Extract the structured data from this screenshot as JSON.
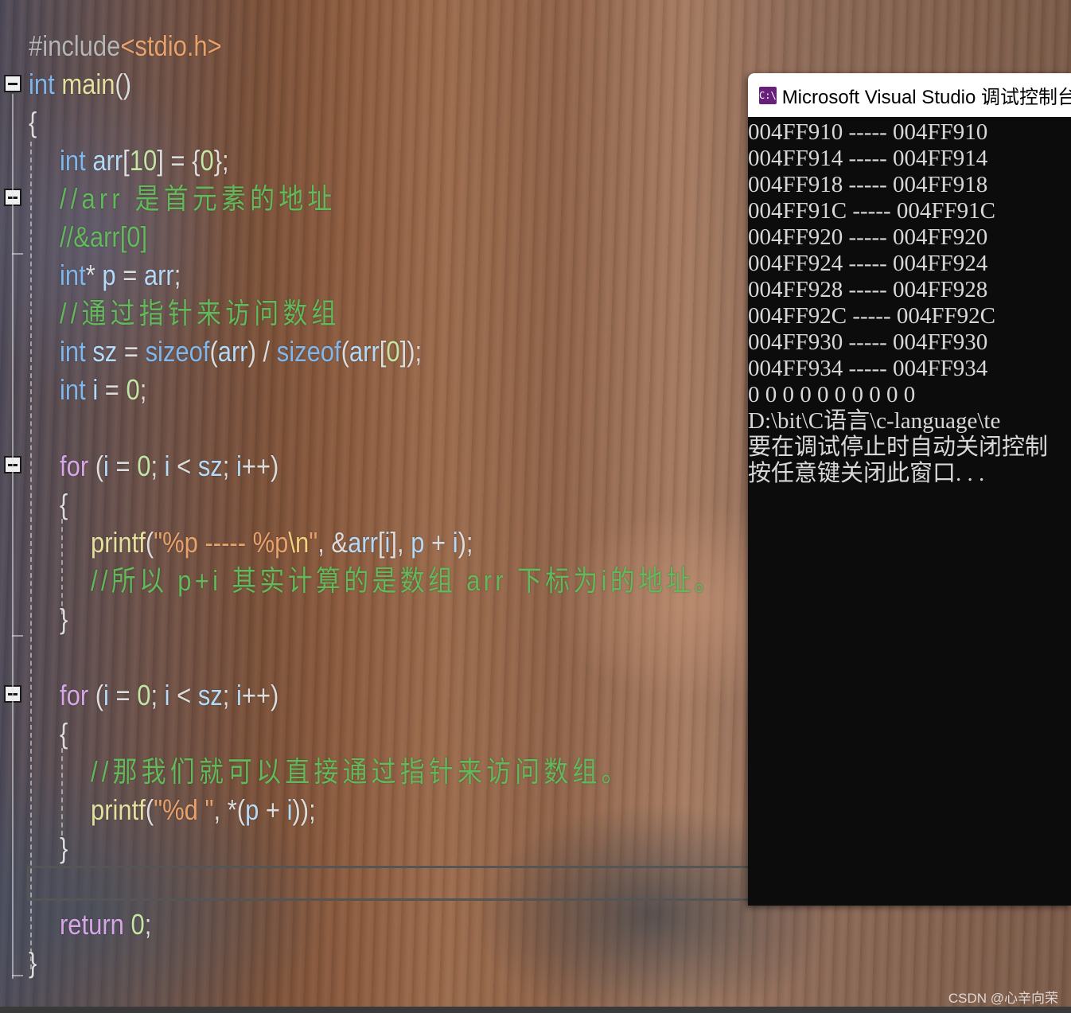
{
  "editor": {
    "line1": {
      "directive": "#include",
      "open": "<",
      "header": "stdio.h",
      "close": ">"
    },
    "line2": {
      "type": "int",
      "name": "main",
      "parens": "()"
    },
    "brace_open": "{",
    "line4": {
      "type": "int",
      "arr": "arr",
      "lb": "[",
      "size": "10",
      "rb": "]",
      "eq": " = {",
      "zero": "0",
      "end": "};"
    },
    "comment1": "//arr 是首元素的地址",
    "comment2": "//&arr[0]",
    "line7": {
      "type": "int",
      "star": "*",
      "p": "p",
      "eq": " = ",
      "arr": "arr",
      "end": ";"
    },
    "comment3": "//通过指针来访问数组",
    "line9": {
      "type": "int",
      "sz": "sz",
      "eq": " = ",
      "fn1": "sizeof",
      "lp1": "(",
      "arr1": "arr",
      "mid": ") / ",
      "fn2": "sizeof",
      "lp2": "(",
      "arr2": "arr",
      "lb": "[",
      "zero": "0",
      "end": "]);"
    },
    "line10": {
      "type": "int",
      "i": "i",
      "eq": " = ",
      "zero": "0",
      "end": ";"
    },
    "for1": {
      "kw": "for",
      "lp": " (",
      "i1": "i",
      "eq": " = ",
      "zero": "0",
      "semi1": "; ",
      "i2": "i",
      "lt": " < ",
      "sz": "sz",
      "semi2": "; ",
      "i3": "i",
      "inc": "++)"
    },
    "for1_open": "{",
    "printf1": {
      "fn": "printf",
      "lp": "(",
      "str": "\"%p ----- %p",
      "esc": "\\n",
      "strend": "\"",
      "comma1": ", &",
      "arr": "arr",
      "lb": "[",
      "i": "i",
      "rb": "], ",
      "p": "p",
      "plus": " + ",
      "i2": "i",
      "end": ");"
    },
    "comment4": "//所以 p+i 其实计算的是数组 arr 下标为i的地址。",
    "for1_close": "}",
    "for2": {
      "kw": "for",
      "lp": " (",
      "i1": "i",
      "eq": " = ",
      "zero": "0",
      "semi1": "; ",
      "i2": "i",
      "lt": " < ",
      "sz": "sz",
      "semi2": "; ",
      "i3": "i",
      "inc": "++)"
    },
    "for2_open": "{",
    "comment5": "//那我们就可以直接通过指针来访问数组。",
    "printf2": {
      "fn": "printf",
      "lp": "(",
      "str": "\"%d \"",
      "mid": ", *(",
      "p": "p",
      "plus": " + ",
      "i": "i",
      "end": "));"
    },
    "for2_close": "}",
    "ret": {
      "kw": "return",
      "sp": " ",
      "zero": "0",
      "end": ";"
    },
    "brace_close": "}"
  },
  "console": {
    "title": "Microsoft Visual Studio 调试控制台",
    "icon": "console-app-icon",
    "icon_text": "C:\\",
    "lines": [
      "004FF910 ----- 004FF910",
      "004FF914 ----- 004FF914",
      "004FF918 ----- 004FF918",
      "004FF91C ----- 004FF91C",
      "004FF920 ----- 004FF920",
      "004FF924 ----- 004FF924",
      "004FF928 ----- 004FF928",
      "004FF92C ----- 004FF92C",
      "004FF930 ----- 004FF930",
      "004FF934 ----- 004FF934",
      "0 0 0 0 0 0 0 0 0 0",
      "D:\\bit\\C语言\\c-language\\te",
      "要在调试停止时自动关闭控制",
      "按任意键关闭此窗口. . ."
    ]
  },
  "watermark": "CSDN @心辛向荣",
  "colors": {
    "keyword": "#7fb6ec",
    "control": "#d7a6e8",
    "function": "#e3e19d",
    "variable": "#b4daf7",
    "number": "#c3e4a4",
    "string": "#e8a16a",
    "comment": "#62b85a",
    "console_bg": "#0c0c0c",
    "console_text": "#d8d8d8",
    "vs_purple": "#68217a"
  }
}
